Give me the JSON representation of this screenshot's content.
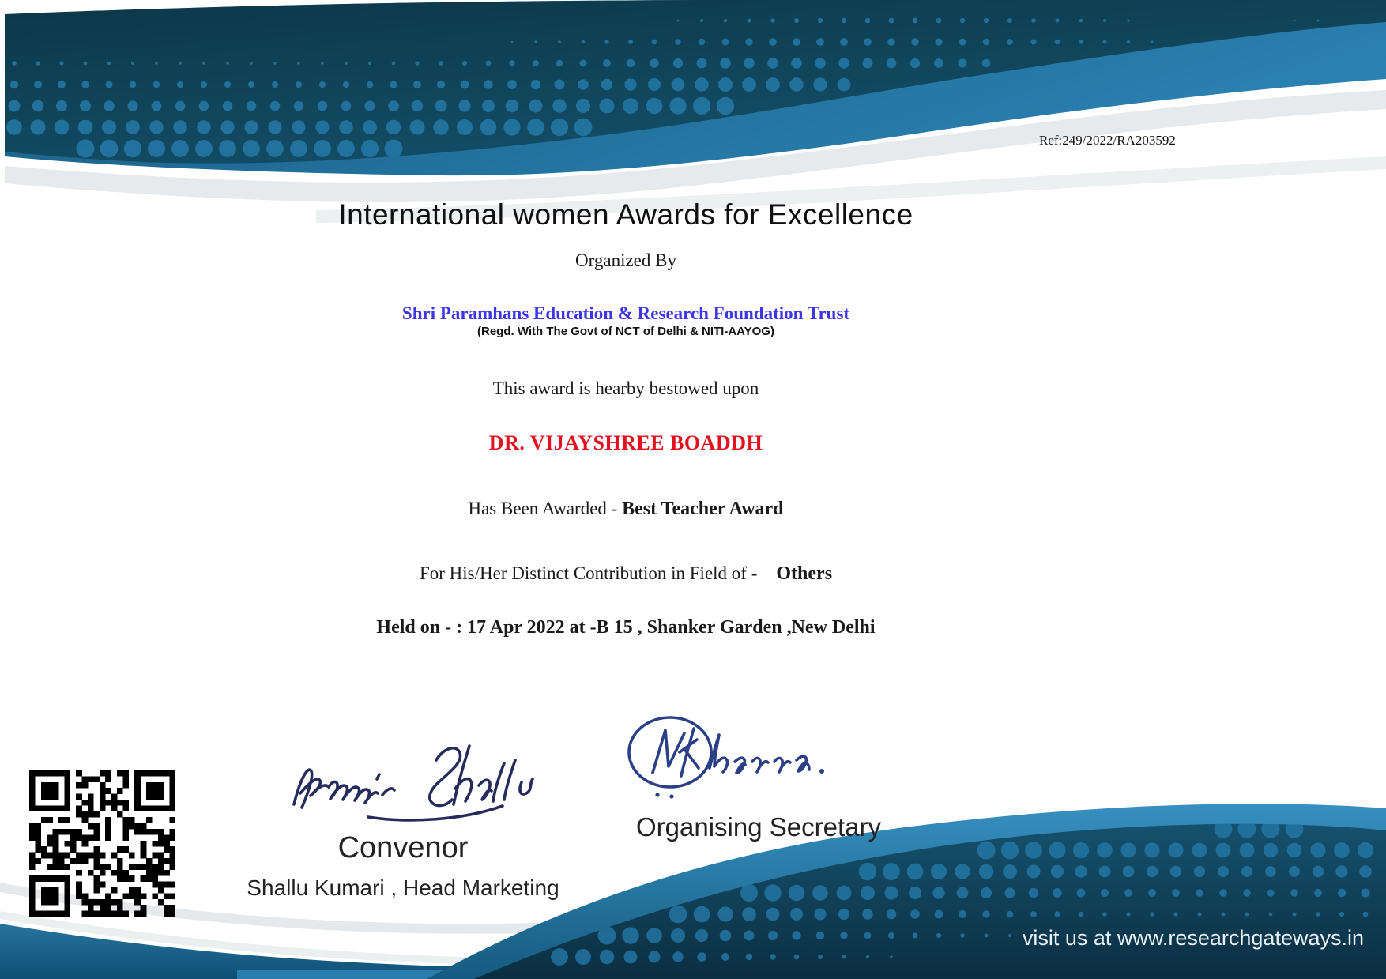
{
  "colors": {
    "organization_blue": "#3c35ea",
    "recipient_red": "#e3101f",
    "band_dark": "#0e3b51",
    "band_blue": "#1f6f9f",
    "dot_blue": "#2579a9",
    "footer_text_color": "#e9f2f8",
    "signature_ink_convenor": "#262b5c",
    "signature_ink_secretary": "#2a3f85"
  },
  "header": {
    "ref": "Ref:249/2022/RA203592"
  },
  "certificate": {
    "title": "International women Awards for Excellence",
    "organized_by": "Organized By",
    "organization": "Shri Paramhans Education & Research Foundation Trust",
    "organization_registration": "(Regd. With The Govt of NCT of Delhi & NITI-AAYOG)",
    "bestowed_line": "This award is hearby bestowed upon",
    "recipient": "DR. VIJAYSHREE BOADDH",
    "awarded_prefix": "Has Been Awarded - ",
    "award_name": "Best Teacher Award",
    "field_prefix": "For His/Her Distinct Contribution in Field of -",
    "field_value": "Others",
    "event_line": "Held on - : 17 Apr 2022 at -B 15 , Shanker Garden ,New Delhi"
  },
  "signatories": {
    "convenor": {
      "title": "Convenor",
      "detail": "Shallu Kumari , Head Marketing"
    },
    "organising_secretary": {
      "title": "Organising Secretary"
    }
  },
  "footer": {
    "website_line": "visit us at www.researchgateways.in"
  }
}
